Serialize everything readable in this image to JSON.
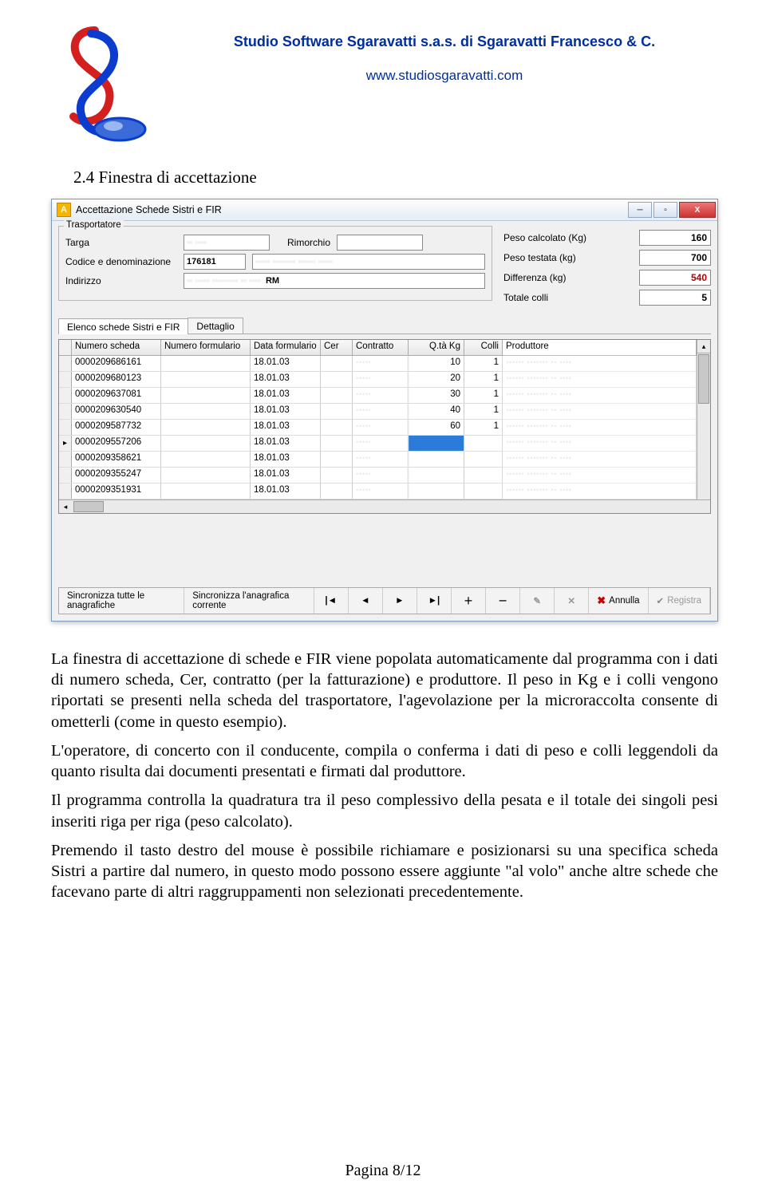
{
  "header": {
    "company": "Studio Software Sgaravatti s.a.s. di Sgaravatti Francesco & C.",
    "website": "www.studiosgaravatti.com"
  },
  "section": {
    "title": "2.4 Finestra di accettazione"
  },
  "window": {
    "title": "Accettazione Schede Sistri e FIR",
    "icon_letter": "A",
    "trasportatore": {
      "legend": "Trasportatore",
      "targa_label": "Targa",
      "targa": "",
      "rimorchio_label": "Rimorchio",
      "rimorchio": "",
      "codice_label": "Codice e denominazione",
      "codice": "176181",
      "denominazione": "",
      "indirizzo_label": "Indirizzo",
      "indirizzo_city": "RM"
    },
    "summary": {
      "peso_calcolato_label": "Peso calcolato (Kg)",
      "peso_calcolato": "160",
      "peso_testata_label": "Peso testata (kg)",
      "peso_testata": "700",
      "differenza_label": "Differenza (kg)",
      "differenza": "540",
      "totale_colli_label": "Totale colli",
      "totale_colli": "5"
    },
    "tabs": {
      "t1": "Elenco schede Sistri e FIR",
      "t2": "Dettaglio"
    },
    "columns": {
      "c1": "Numero scheda",
      "c2": "Numero formulario",
      "c3": "Data formulario",
      "c4": "Cer",
      "c5": "Contratto",
      "c6": "Q.tà Kg",
      "c7": "Colli",
      "c8": "Produttore"
    },
    "rows": [
      {
        "sel": "",
        "n": "0000209686161",
        "nf": "",
        "df": "18.01.03",
        "cer": "",
        "con": "",
        "kg": "10",
        "colli": "1",
        "prod": ""
      },
      {
        "sel": "",
        "n": "0000209680123",
        "nf": "",
        "df": "18.01.03",
        "cer": "",
        "con": "",
        "kg": "20",
        "colli": "1",
        "prod": ""
      },
      {
        "sel": "",
        "n": "0000209637081",
        "nf": "",
        "df": "18.01.03",
        "cer": "",
        "con": "",
        "kg": "30",
        "colli": "1",
        "prod": ""
      },
      {
        "sel": "",
        "n": "0000209630540",
        "nf": "",
        "df": "18.01.03",
        "cer": "",
        "con": "",
        "kg": "40",
        "colli": "1",
        "prod": ""
      },
      {
        "sel": "",
        "n": "0000209587732",
        "nf": "",
        "df": "18.01.03",
        "cer": "",
        "con": "",
        "kg": "60",
        "colli": "1",
        "prod": ""
      },
      {
        "sel": "▸",
        "n": "0000209557206",
        "nf": "",
        "df": "18.01.03",
        "cer": "",
        "con": "",
        "kg": "",
        "colli": "",
        "prod": "",
        "selected": true
      },
      {
        "sel": "",
        "n": "0000209358621",
        "nf": "",
        "df": "18.01.03",
        "cer": "",
        "con": "",
        "kg": "",
        "colli": "",
        "prod": ""
      },
      {
        "sel": "",
        "n": "0000209355247",
        "nf": "",
        "df": "18.01.03",
        "cer": "",
        "con": "",
        "kg": "",
        "colli": "",
        "prod": ""
      },
      {
        "sel": "",
        "n": "0000209351931",
        "nf": "",
        "df": "18.01.03",
        "cer": "",
        "con": "",
        "kg": "",
        "colli": "",
        "prod": ""
      }
    ],
    "toolbar": {
      "sync_all": "Sincronizza tutte le anagrafiche",
      "sync_current": "Sincronizza l'anagrafica corrente",
      "nav": {
        "first": "|◄",
        "prev": "◄",
        "next": "►",
        "last": "►|",
        "add": "＋",
        "del": "－",
        "edit": "✎",
        "cancel_edit": "✕"
      },
      "annulla": "Annulla",
      "registra": "Registra"
    }
  },
  "paragraphs": {
    "p1": "La finestra di accettazione di schede e FIR viene popolata automaticamente dal programma con i dati di numero scheda, Cer, contratto (per la fatturazione) e produttore. Il peso in Kg e i colli vengono riportati se presenti nella scheda del trasportatore, l'agevolazione per la microraccolta consente di ometterli (come in questo esempio).",
    "p2": "L'operatore, di concerto con il conducente, compila o conferma i dati di peso e colli leggendoli da quanto risulta dai documenti presentati e firmati dal produttore.",
    "p3": "Il programma controlla la quadratura tra il peso complessivo della pesata e il totale dei singoli pesi inseriti riga per riga (peso calcolato).",
    "p4": "Premendo il tasto destro del mouse è possibile richiamare e posizionarsi su una specifica scheda Sistri a partire dal numero, in questo modo possono essere aggiunte \"al volo\" anche altre schede che facevano parte di altri raggruppamenti non selezionati precedentemente."
  },
  "footer": "Pagina 8/12"
}
